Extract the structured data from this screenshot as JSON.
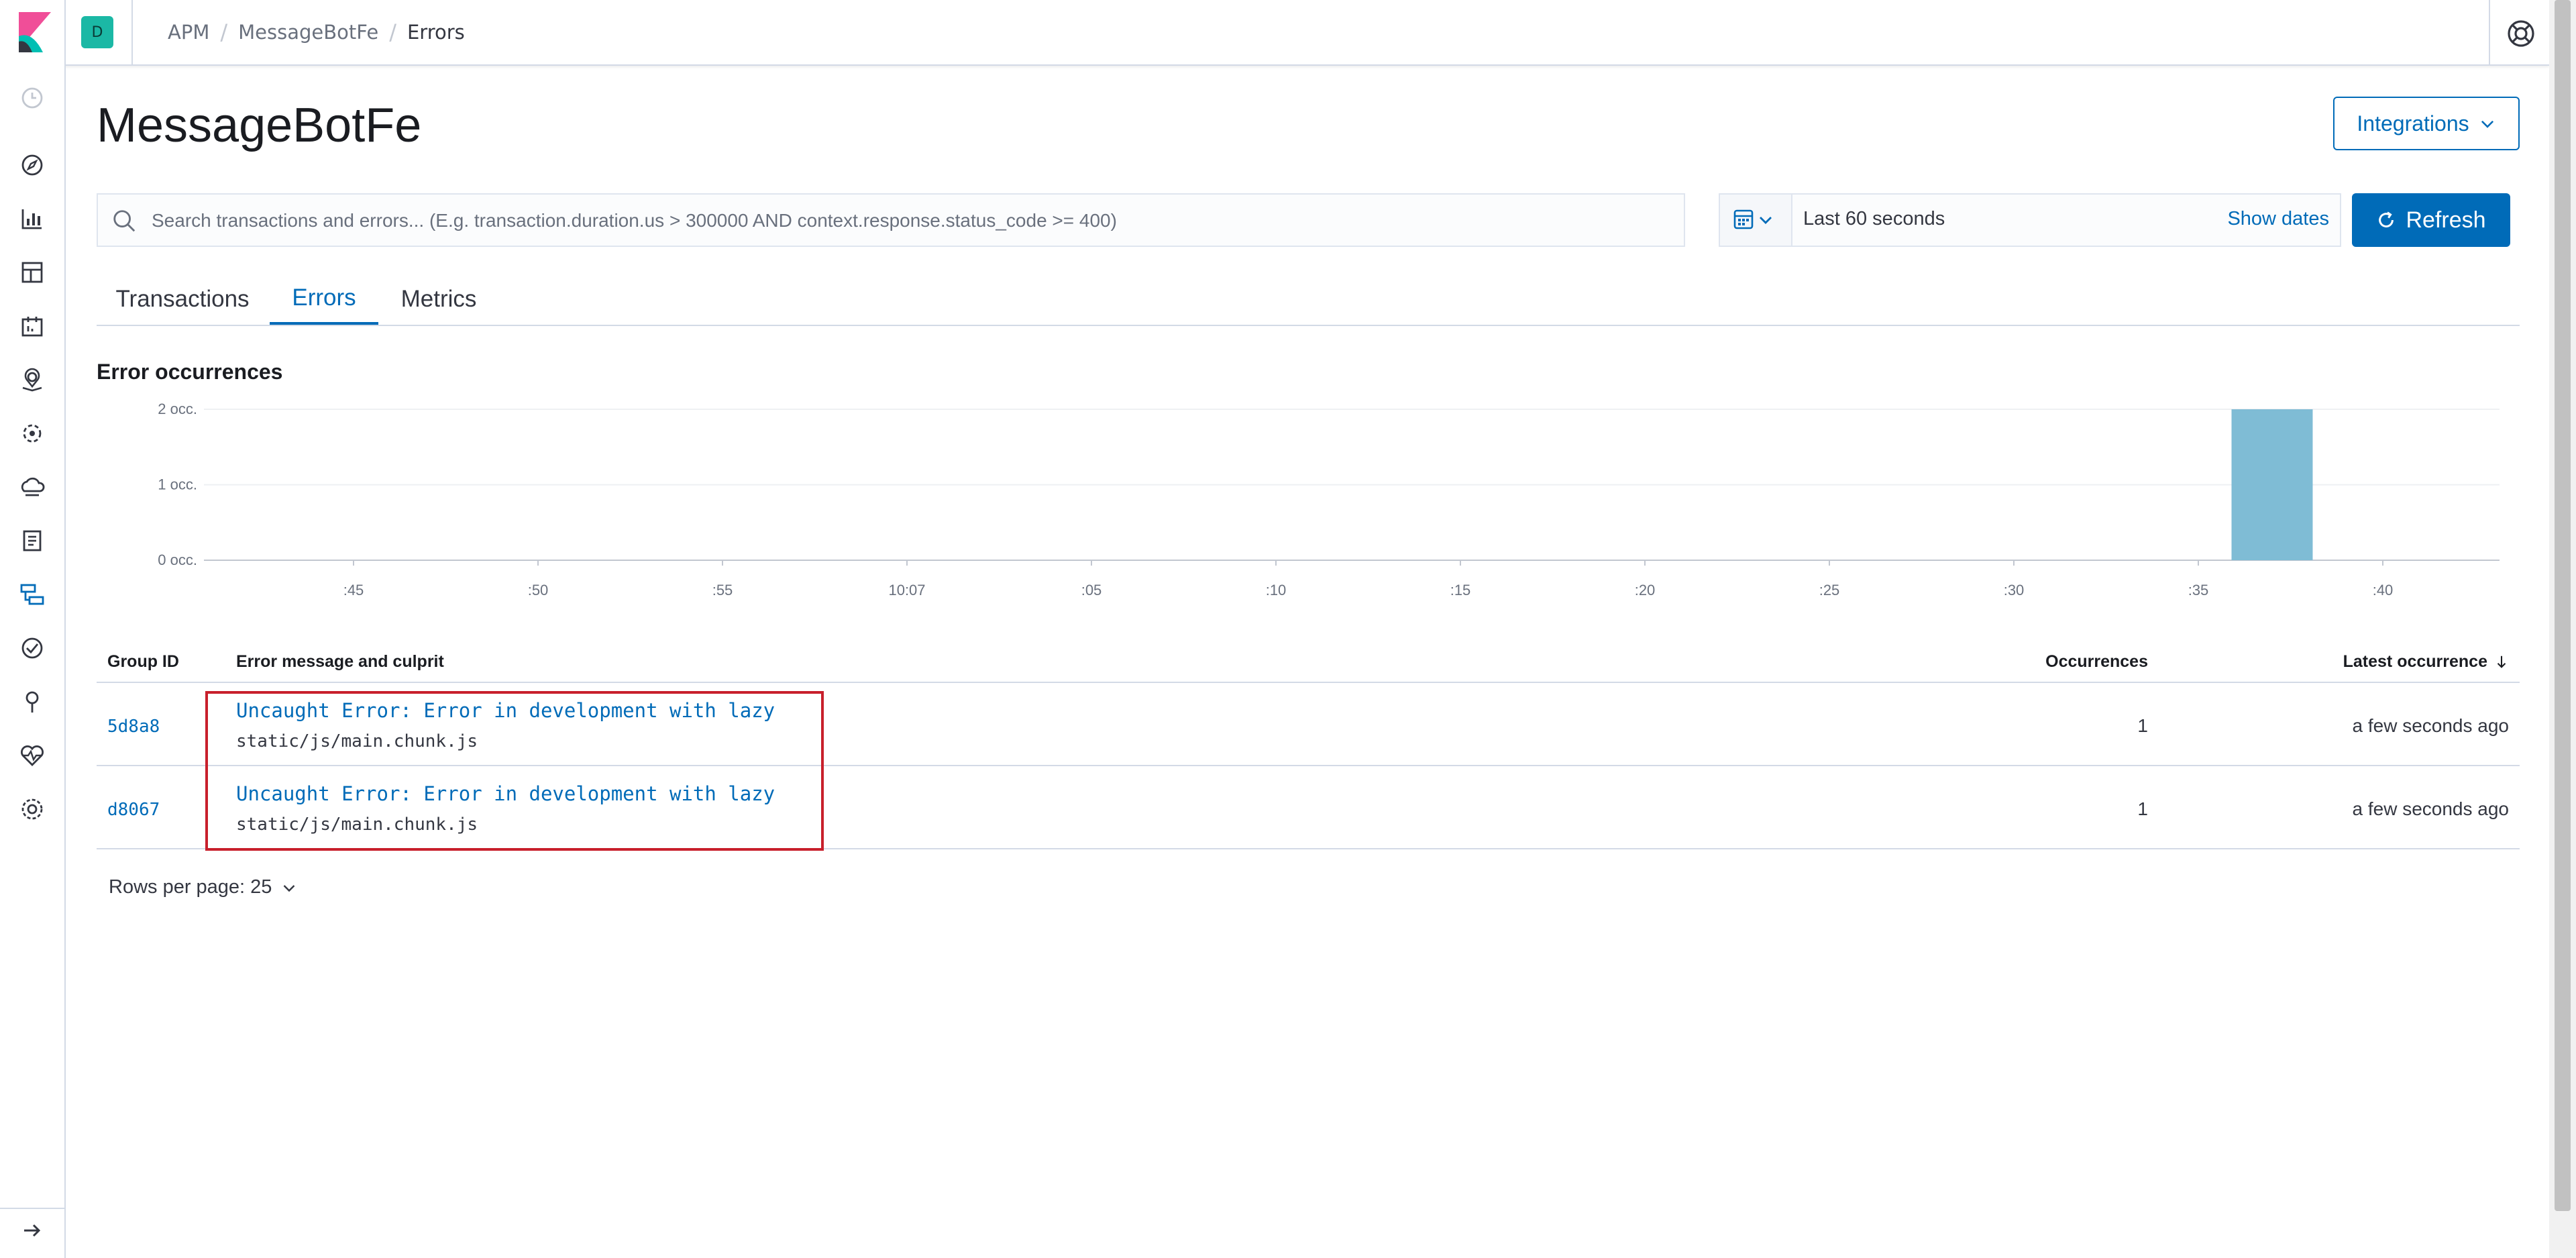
{
  "header": {
    "space_initial": "D",
    "breadcrumbs": [
      "APM",
      "MessageBotFe",
      "Errors"
    ]
  },
  "page": {
    "title": "MessageBotFe",
    "integrations_label": "Integrations"
  },
  "search": {
    "placeholder": "Search transactions and errors... (E.g. transaction.duration.us > 300000 AND context.response.status_code >= 400)",
    "value": ""
  },
  "date_picker": {
    "range_label": "Last 60 seconds",
    "show_dates_label": "Show dates"
  },
  "refresh_label": "Refresh",
  "tabs": [
    {
      "label": "Transactions",
      "active": false
    },
    {
      "label": "Errors",
      "active": true
    },
    {
      "label": "Metrics",
      "active": false
    }
  ],
  "section_title": "Error occurrences",
  "chart_data": {
    "type": "bar",
    "title": "Error occurrences",
    "y_ticks": [
      "0 occ.",
      "1 occ.",
      "2 occ."
    ],
    "x_ticks": [
      ":45",
      ":50",
      ":55",
      "10:07",
      ":05",
      ":10",
      ":15",
      ":20",
      ":25",
      ":30",
      ":35",
      ":40"
    ],
    "ylim": [
      0,
      2
    ],
    "grid": true,
    "bar_color": "#7fbcd5",
    "bars": [
      {
        "x": ":37",
        "value": 2
      }
    ]
  },
  "table": {
    "headers": {
      "group_id": "Group ID",
      "message": "Error message and culprit",
      "occurrences": "Occurrences",
      "latest": "Latest occurrence"
    },
    "rows": [
      {
        "group_id": "5d8a8",
        "message": "Uncaught Error: Error in development with lazy",
        "culprit": "static/js/main.chunk.js",
        "occurrences": "1",
        "latest": "a few seconds ago"
      },
      {
        "group_id": "d8067",
        "message": "Uncaught Error: Error in development with lazy",
        "culprit": "static/js/main.chunk.js",
        "occurrences": "1",
        "latest": "a few seconds ago"
      }
    ]
  },
  "pagination": {
    "rows_per_page_label": "Rows per page: 25"
  }
}
